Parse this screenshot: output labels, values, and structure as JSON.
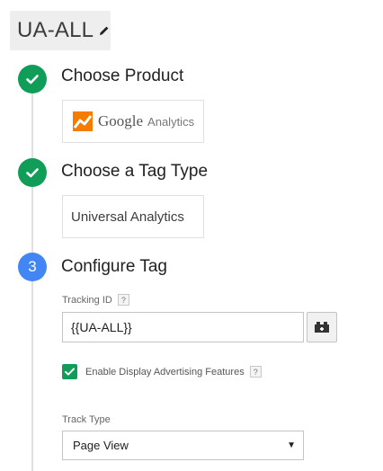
{
  "tag": {
    "name": "UA-ALL"
  },
  "steps": [
    {
      "status": "done",
      "title": "Choose Product"
    },
    {
      "status": "done",
      "title": "Choose a Tag Type"
    },
    {
      "status": "active",
      "number": "3",
      "title": "Configure Tag"
    }
  ],
  "product_card": {
    "brand": "Google",
    "product": "Analytics"
  },
  "tag_type_card": {
    "label": "Universal Analytics"
  },
  "tracking_id": {
    "label": "Tracking ID",
    "help": "?",
    "value": "{{UA-ALL}}"
  },
  "display_advertising": {
    "label": "Enable Display Advertising Features",
    "help": "?",
    "checked": true
  },
  "track_type": {
    "label": "Track Type",
    "selected": "Page View"
  },
  "colors": {
    "success": "#0f9d58",
    "accent": "#4285f4",
    "ga_orange": "#f57c00"
  }
}
